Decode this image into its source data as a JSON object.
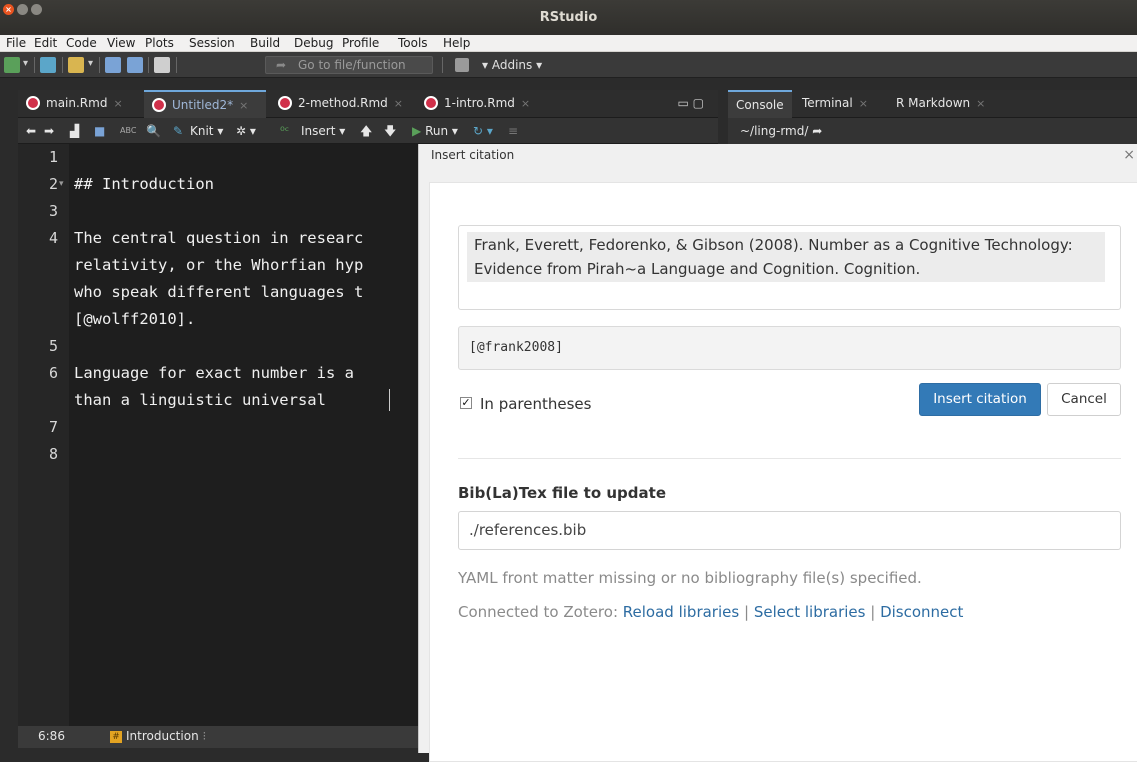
{
  "window": {
    "title": "RStudio"
  },
  "menubar": [
    "File",
    "Edit",
    "Code",
    "View",
    "Plots",
    "Session",
    "Build",
    "Debug",
    "Profile",
    "Tools",
    "Help"
  ],
  "main_toolbar": {
    "goto_placeholder": "Go to file/function",
    "addins_label": "Addins"
  },
  "editor": {
    "tabs": [
      {
        "label": "main.Rmd",
        "active": false
      },
      {
        "label": "Untitled2*",
        "active": true
      },
      {
        "label": "2-method.Rmd",
        "active": false
      },
      {
        "label": "1-intro.Rmd",
        "active": false
      }
    ],
    "toolbar": {
      "knit_label": "Knit",
      "insert_label": "Insert",
      "run_label": "Run"
    },
    "line_numbers": [
      "1",
      "2",
      "3",
      "4",
      "5",
      "6",
      "7",
      "8"
    ],
    "lines": [
      "",
      "## Introduction",
      "",
      "The central question in researc",
      "relativity, or the Whorfian hyp",
      "who speak different languages t",
      "[@wolff2010].",
      "",
      "Language for exact number is a",
      "than a linguistic universal",
      "",
      ""
    ],
    "status": {
      "position": "6:86",
      "section": "Introduction"
    }
  },
  "console": {
    "tabs": [
      {
        "label": "Console",
        "active": true
      },
      {
        "label": "Terminal",
        "active": false
      },
      {
        "label": "R Markdown",
        "active": false
      }
    ],
    "path": "~/ling-rmd/"
  },
  "dialog": {
    "title": "Insert citation",
    "reference": "Frank, Everett, Fedorenko, & Gibson (2008). Number as a Cognitive Technology: Evidence from Pirah~a Language and Cognition. Cognition.",
    "citation_key": "[@frank2008]",
    "in_parentheses_label": "In parentheses",
    "in_parentheses_checked": true,
    "insert_button": "Insert citation",
    "cancel_button": "Cancel",
    "bib_label": "Bib(La)Tex file to update",
    "bib_value": "./references.bib",
    "yaml_message": "YAML front matter missing or no bibliography file(s) specified.",
    "zotero_prefix": "Connected to Zotero:",
    "zotero_links": [
      "Reload libraries",
      "Select libraries",
      "Disconnect"
    ],
    "zotero_sep": "|"
  },
  "colors": {
    "accent": "#337ab7",
    "link": "#2d6ca2",
    "rmd_icon": "#d0304a"
  }
}
